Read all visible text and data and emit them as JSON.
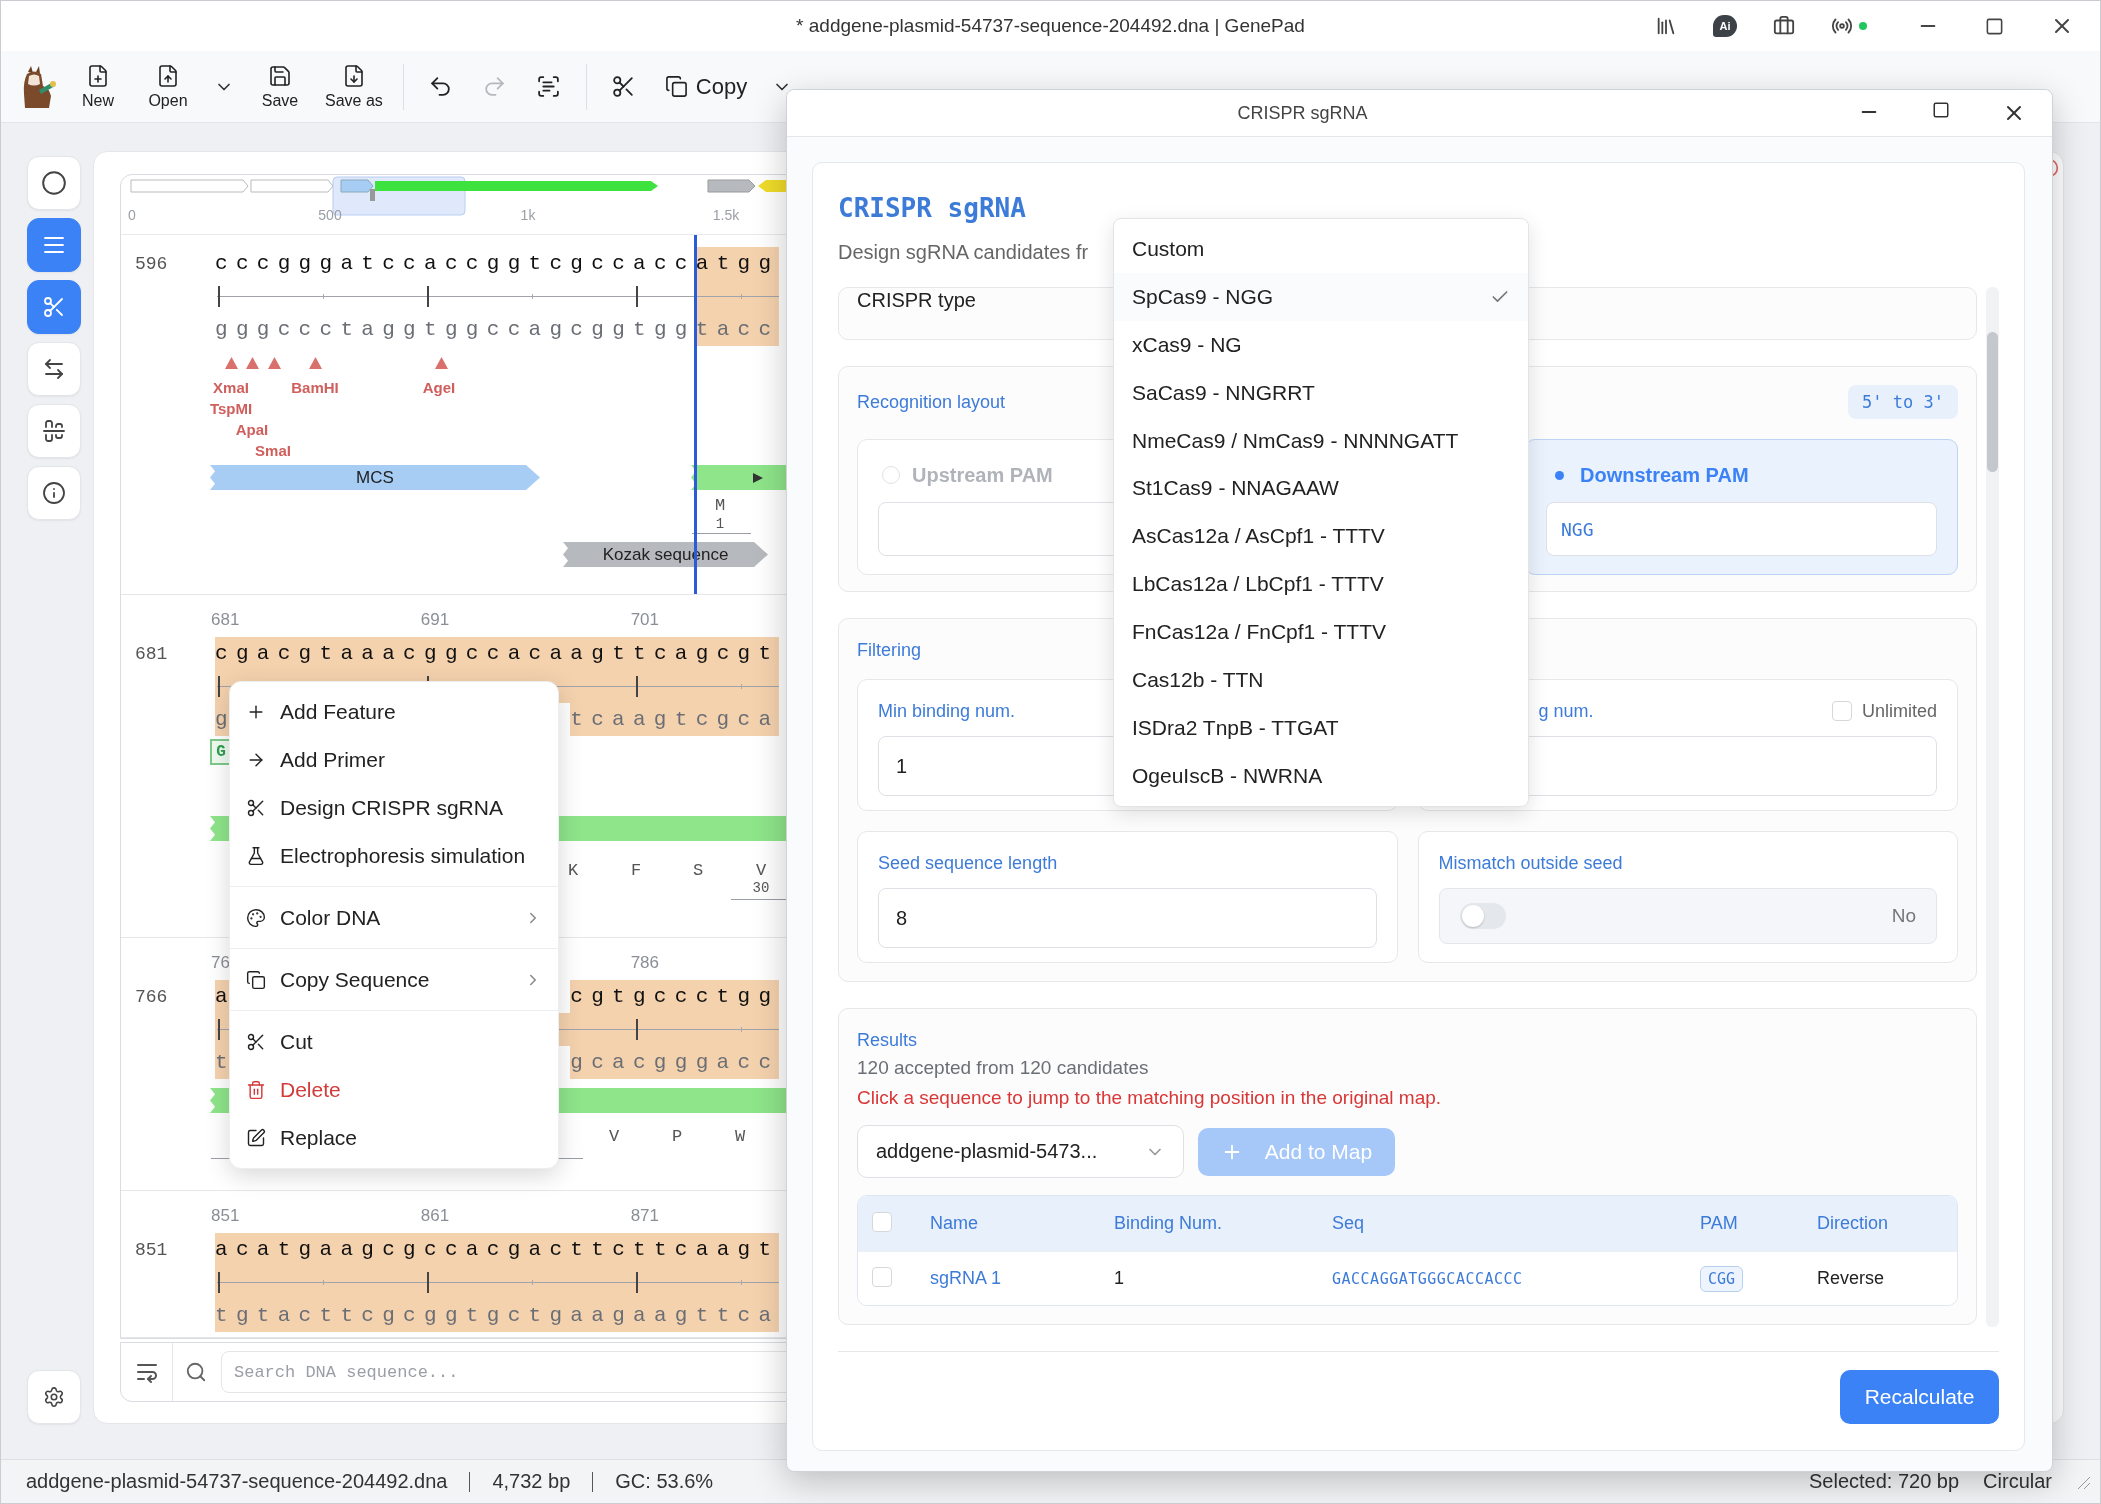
{
  "window": {
    "title": "* addgene-plasmid-54737-sequence-204492.dna | GenePad",
    "ai_badge": "Ai"
  },
  "toolbar": {
    "groups": [
      [
        {
          "kind": "stack",
          "label": "New",
          "disabled": false
        },
        {
          "kind": "stack",
          "label": "Open",
          "disabled": false
        },
        {
          "kind": "caret",
          "disabled": false
        },
        {
          "kind": "stack",
          "label": "Save",
          "disabled": false
        },
        {
          "kind": "stack",
          "label": "Save as",
          "disabled": false
        }
      ],
      [
        {
          "kind": "icon",
          "disabled": false
        },
        {
          "kind": "icon",
          "disabled": true
        },
        {
          "kind": "icon",
          "disabled": false
        }
      ],
      [
        {
          "kind": "icon",
          "disabled": false
        },
        {
          "kind": "inline",
          "label": "Copy",
          "disabled": false
        },
        {
          "kind": "caret",
          "disabled": false
        }
      ]
    ]
  },
  "sidebar": {
    "items": [
      {
        "selected": false
      },
      {
        "selected": true
      },
      {
        "selected": true
      },
      {
        "selected": false
      },
      {
        "selected": false
      },
      {
        "selected": false
      }
    ]
  },
  "overview": {
    "ticks": [
      "0",
      "500",
      "1k",
      "1.5k"
    ]
  },
  "sequence": {
    "rows": [
      {
        "number": "596",
        "cursor": true,
        "top": [
          {
            "text": "cccgggatccaccggtcgccacc",
            "selected": false
          },
          {
            "text": "atgg",
            "selected": true
          }
        ],
        "bottom": [
          {
            "text": "gggccctaggtggccagcggtgg",
            "selected": false
          },
          {
            "text": "tacc",
            "selected": true
          }
        ],
        "track": [
          {
            "kind": "enzyme",
            "label": "XmaI"
          },
          {
            "kind": "enzyme",
            "label": "TspMI"
          },
          {
            "kind": "enzyme",
            "label": "ApaI"
          },
          {
            "kind": "enzyme",
            "label": "SmaI"
          },
          {
            "kind": "enzyme",
            "label": "BamHI"
          },
          {
            "kind": "enzyme",
            "label": "AgeI"
          },
          {
            "kind": "feature",
            "label": "MCS",
            "color": "#a8cdf5"
          },
          {
            "kind": "cds",
            "color": "#8ee58a"
          },
          {
            "kind": "amino",
            "label": "M"
          },
          {
            "kind": "index",
            "label": "1"
          },
          {
            "kind": "feature",
            "label": "Kozak sequence",
            "color": "#b6babf"
          }
        ]
      },
      {
        "number": "681",
        "cursor": false,
        "positions": [
          "681",
          "691",
          "701"
        ],
        "top": [
          {
            "text": "cgacgtaaacggccacaagttcagcgt",
            "selected": true
          }
        ],
        "bottom": [
          {
            "text": "g",
            "selected": true
          },
          {
            "text": "tcaagtcgca",
            "selected": true
          }
        ],
        "track": [
          {
            "kind": "base",
            "label": "G"
          },
          {
            "kind": "cds",
            "color": "#8ee58a"
          },
          {
            "kind": "amino",
            "label": "K"
          },
          {
            "kind": "amino",
            "label": "F"
          },
          {
            "kind": "amino",
            "label": "S"
          },
          {
            "kind": "amino",
            "label": "V"
          },
          {
            "kind": "index",
            "label": "30"
          }
        ]
      },
      {
        "number": "766",
        "cursor": false,
        "positions": [
          "76",
          "786"
        ],
        "top": [
          {
            "text": "a",
            "selected": true
          },
          {
            "text": "cgtgccctgg",
            "selected": true
          }
        ],
        "bottom": [
          {
            "text": "t",
            "selected": true
          },
          {
            "text": "gcacgggacc",
            "selected": true
          }
        ],
        "track": [
          {
            "kind": "cds",
            "color": "#8ee58a"
          },
          {
            "kind": "amino",
            "label": "V"
          },
          {
            "kind": "amino",
            "label": "P"
          },
          {
            "kind": "amino",
            "label": "W"
          }
        ]
      },
      {
        "number": "851",
        "cursor": false,
        "positions": [
          "851",
          "861",
          "871"
        ],
        "top": [
          {
            "text": "acatgaagcgccacgacttcttcaagt",
            "selected": true
          }
        ],
        "bottom": [
          {
            "text": "tgtacttcgcggtgctgaagaagttca",
            "selected": true
          }
        ]
      }
    ]
  },
  "search": {
    "placeholder": "Search DNA sequence..."
  },
  "context_menu": {
    "groups": [
      [
        {
          "label": "Add Feature",
          "submenu": false,
          "danger": false
        },
        {
          "label": "Add Primer",
          "submenu": false,
          "danger": false
        },
        {
          "label": "Design CRISPR sgRNA",
          "submenu": false,
          "danger": false
        },
        {
          "label": "Electrophoresis simulation",
          "submenu": false,
          "danger": false
        }
      ],
      [
        {
          "label": "Color DNA",
          "submenu": true,
          "danger": false
        }
      ],
      [
        {
          "label": "Copy Sequence",
          "submenu": true,
          "danger": false
        }
      ],
      [
        {
          "label": "Cut",
          "submenu": false,
          "danger": false
        },
        {
          "label": "Delete",
          "submenu": false,
          "danger": true
        },
        {
          "label": "Replace",
          "submenu": false,
          "danger": false
        }
      ]
    ]
  },
  "status_bar": {
    "items": [
      "addgene-plasmid-54737-sequence-204492.dna",
      "4,732 bp",
      "GC: 53.6%"
    ],
    "selected": "Selected: 720 bp",
    "topology": "Circular"
  },
  "dialog": {
    "title": "CRISPR sgRNA",
    "heading": "CRISPR sgRNA",
    "subtitle": "Design sgRNA candidates fr",
    "crispr_type": {
      "label": "CRISPR type"
    },
    "recognition": {
      "title": "Recognition layout",
      "orientation": "5' to 3'",
      "options": [
        {
          "label": "Upstream PAM",
          "selected": false
        },
        {
          "label": "Downstream PAM",
          "selected": true,
          "value": "NGG"
        }
      ]
    },
    "filtering": {
      "title": "Filtering",
      "fields": [
        {
          "kind": "input",
          "label": "Min binding num.",
          "value": "1"
        },
        {
          "kind": "input",
          "label": "g num.",
          "unlimited": {
            "label": "Unlimited",
            "checked": false
          }
        },
        {
          "kind": "input",
          "label": "Seed sequence length",
          "value": "8"
        },
        {
          "kind": "toggle",
          "label": "Mismatch outside seed",
          "on": false,
          "state_text": "No"
        }
      ]
    },
    "results": {
      "title": "Results",
      "summary": "120 accepted from 120 candidates",
      "note": "Click a sequence to jump to the matching position in the original map.",
      "target": "addgene-plasmid-5473...",
      "add_button": {
        "label": "Add to Map",
        "disabled": true
      },
      "table": {
        "all_checked": false,
        "columns": [
          "Name",
          "Binding Num.",
          "Seq",
          "PAM",
          "Direction"
        ],
        "rows": [
          {
            "checked": false,
            "name": "sgRNA 1",
            "binding": "1",
            "seq": "GACCAGGATGGGCACCACCC",
            "pam": "CGG",
            "direction": "Reverse"
          }
        ]
      }
    },
    "recalculate": "Recalculate"
  },
  "crispr_menu": {
    "options": [
      {
        "label": "Custom",
        "selected": false
      },
      {
        "label": "SpCas9 - NGG",
        "selected": true
      },
      {
        "label": "xCas9 - NG",
        "selected": false
      },
      {
        "label": "SaCas9 - NNGRRT",
        "selected": false
      },
      {
        "label": "NmeCas9 / NmCas9 - NNNNGATT",
        "selected": false
      },
      {
        "label": "St1Cas9 - NNAGAAW",
        "selected": false
      },
      {
        "label": "AsCas12a / AsCpf1 - TTTV",
        "selected": false
      },
      {
        "label": "LbCas12a / LbCpf1 - TTTV",
        "selected": false
      },
      {
        "label": "FnCas12a / FnCpf1 - TTTV",
        "selected": false
      },
      {
        "label": "Cas12b - TTN",
        "selected": false
      },
      {
        "label": "ISDra2 TnpB - TTGAT",
        "selected": false
      },
      {
        "label": "OgeuIscB - NWRNA",
        "selected": false
      }
    ]
  }
}
